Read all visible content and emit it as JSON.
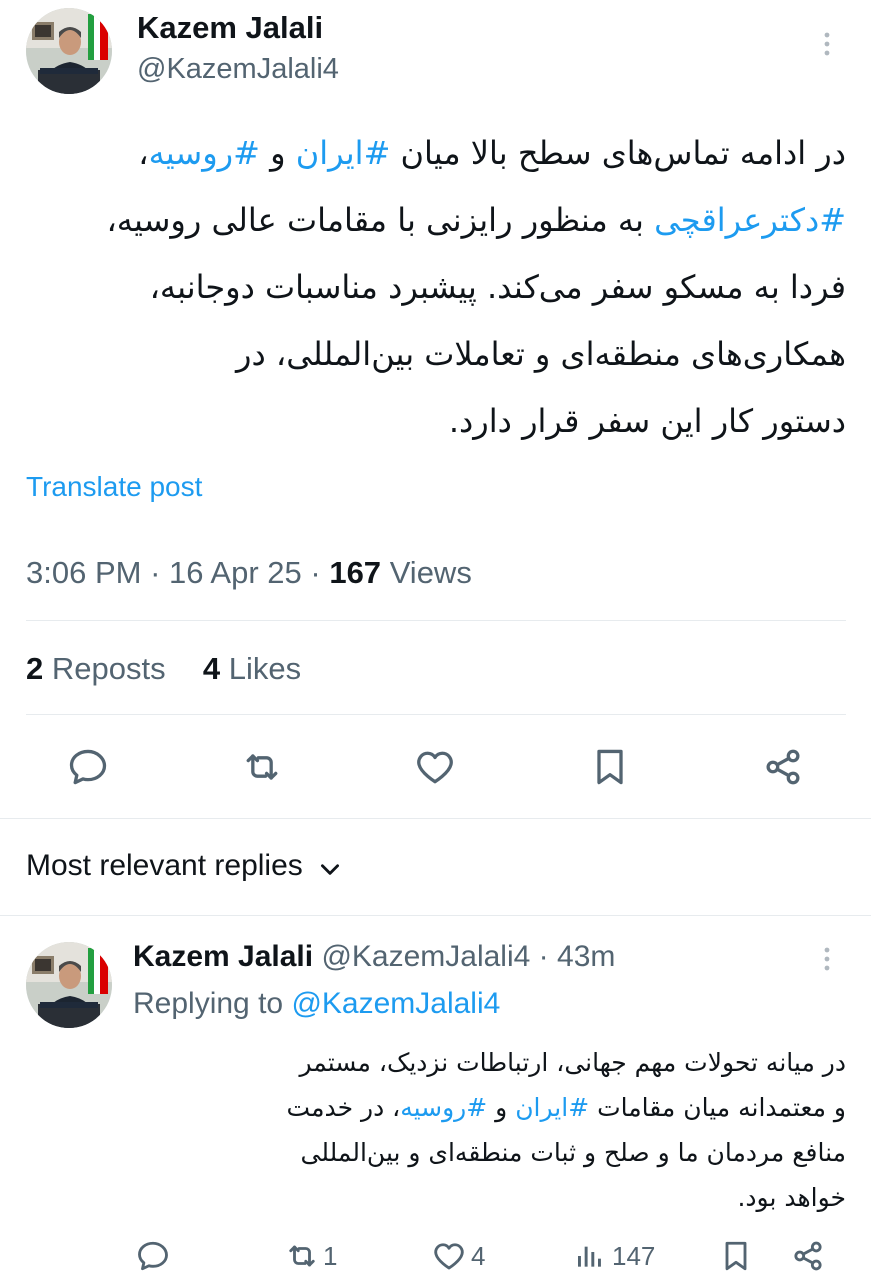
{
  "post": {
    "author_name": "Kazem Jalali",
    "author_handle": "@KazemJalali4",
    "text_lines": [
      {
        "parts": [
          {
            "t": "در ادامه تماس‌های سطح بالا میان ",
            "tag": false
          },
          {
            "t": "#ایران",
            "tag": true
          },
          {
            "t": " و ",
            "tag": false
          },
          {
            "t": "#روسیه",
            "tag": true
          },
          {
            "t": "،",
            "tag": false
          }
        ]
      },
      {
        "parts": [
          {
            "t": "#دکترعراقچی",
            "tag": true
          },
          {
            "t": " به منظور رایزنی با مقامات عالی روسیه،",
            "tag": false
          }
        ]
      },
      {
        "parts": [
          {
            "t": "فردا به مسکو سفر می‌کند. پیشبرد مناسبات دوجانبه،",
            "tag": false
          }
        ]
      },
      {
        "parts": [
          {
            "t": "همکاری‌های منطقه‌ای و تعاملات بین‌المللی، در",
            "tag": false
          }
        ]
      },
      {
        "parts": [
          {
            "t": "دستور کار این سفر قرار دارد.",
            "tag": false
          }
        ]
      }
    ],
    "translate_label": "Translate post",
    "time": "3:06 PM",
    "date": "16 Apr 25",
    "separator": "·",
    "views_count": "167",
    "views_label": "Views",
    "reposts_count": "2",
    "reposts_label": "Reposts",
    "likes_count": "4",
    "likes_label": "Likes"
  },
  "actions": {
    "icons": [
      "reply-icon",
      "repost-icon",
      "like-icon",
      "bookmark-icon",
      "share-icon"
    ]
  },
  "replies_header": {
    "label": "Most relevant replies"
  },
  "reply": {
    "author_name": "Kazem Jalali",
    "author_handle": "@KazemJalali4",
    "separator": "·",
    "age": "43m",
    "replying_to_label": "Replying to",
    "replying_to_handle": "@KazemJalali4",
    "text_lines": [
      {
        "parts": [
          {
            "t": "در میانه تحولات مهم جهانی، ارتباطات نزدیک، مستمر",
            "tag": false
          }
        ]
      },
      {
        "parts": [
          {
            "t": "و معتمدانه میان مقامات ",
            "tag": false
          },
          {
            "t": "#ایران",
            "tag": true
          },
          {
            "t": " و ",
            "tag": false
          },
          {
            "t": "#روسیه",
            "tag": true
          },
          {
            "t": "، در خدمت",
            "tag": false
          }
        ]
      },
      {
        "parts": [
          {
            "t": "منافع مردمان ما و صلح و ثبات منطقه‌ای و بین‌المللی",
            "tag": false
          }
        ]
      },
      {
        "parts": [
          {
            "t": "خواهد بود.",
            "tag": false
          }
        ]
      }
    ],
    "reposts_count": "1",
    "likes_count": "4",
    "views_count": "147"
  },
  "colors": {
    "accent": "#1d9bf0",
    "text": "#0f1419",
    "secondary": "#536471",
    "divider": "#e7ebee"
  }
}
